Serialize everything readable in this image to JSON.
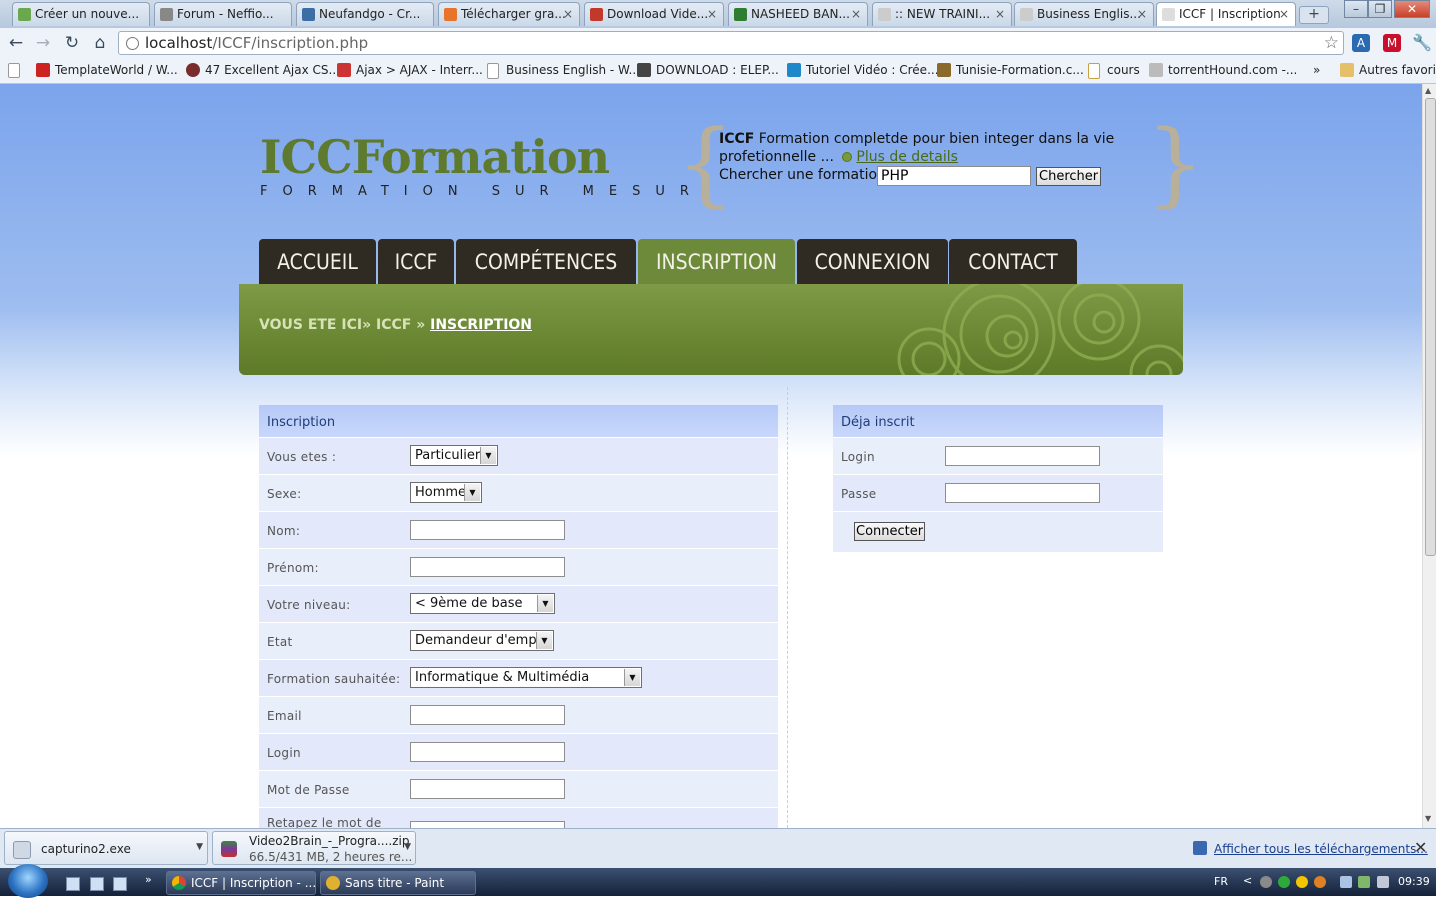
{
  "browser": {
    "tabs": [
      {
        "label": "Créer un nouve...",
        "color": "#6aa84f"
      },
      {
        "label": "Forum - Neffio...",
        "color": "#888888"
      },
      {
        "label": "Neufandgo - Cr...",
        "color": "#3b6ea5"
      },
      {
        "label": "Télécharger gra...",
        "color": "#e8732a"
      },
      {
        "label": "Download Vide...",
        "color": "#c0392b"
      },
      {
        "label": "NASHEED BAN...",
        "color": "#2e7d32"
      },
      {
        "label": ":: NEW TRAINI...",
        "color": "#bbbbbb"
      },
      {
        "label": "Business Englis...",
        "color": "#bbbbbb"
      },
      {
        "label": "ICCF | Inscription",
        "color": "#bbbbbb"
      }
    ],
    "url_host": "localhost",
    "url_path": "/ICCF/inscription.php",
    "bookmarks": [
      {
        "label": "TemplateWorld / W...",
        "color": "#cc2222"
      },
      {
        "label": "47 Excellent Ajax CS...",
        "color": "#7a2b2b"
      },
      {
        "label": "Ajax > AJAX - Interr...",
        "color": "#cc3333"
      },
      {
        "label": "Business English - W...",
        "color": "#dddddd"
      },
      {
        "label": "DOWNLOAD : ELEP...",
        "color": "#444444"
      },
      {
        "label": "Tutoriel Vidéo : Crée...",
        "color": "#1e88c8"
      },
      {
        "label": "Tunisie-Formation.c...",
        "color": "#8a6a2a"
      },
      {
        "label": "cours",
        "color": "#e0c070"
      },
      {
        "label": "torrentHound.com -...",
        "color": "#bbbbbb"
      }
    ],
    "bookmarks_more": "»",
    "other_bookmarks": "Autres favoris"
  },
  "site": {
    "logo": "ICCFormation",
    "tagline": "FORMATION SUR MESUR",
    "promo_brand": "ICCF",
    "promo_text": "Formation completde pour bien integer dans la vie profetionnelle ...",
    "promo_more": "Plus de details",
    "search_label": "Chercher une formation:",
    "search_value": "PHP",
    "search_button": "Chercher",
    "nav": [
      "ACCUEIL",
      "ICCF",
      "COMPÉTENCES",
      "INSCRIPTION",
      "CONNEXION",
      "CONTACT"
    ],
    "nav_active": "INSCRIPTION",
    "breadcrumb_prefix": "VOUS ETE ICI",
    "breadcrumb_sep": "»",
    "breadcrumb_mid": "ICCF",
    "breadcrumb_current": "INSCRIPTION"
  },
  "inscription": {
    "title": "Inscription",
    "rows": [
      {
        "label": "Vous etes :",
        "type": "select",
        "value": "Particulier"
      },
      {
        "label": "Sexe:",
        "type": "select",
        "value": "Homme"
      },
      {
        "label": "Nom:",
        "type": "text",
        "value": ""
      },
      {
        "label": "Prénom:",
        "type": "text",
        "value": ""
      },
      {
        "label": "Votre niveau:",
        "type": "select",
        "value": "< 9ème de base"
      },
      {
        "label": "Etat",
        "type": "select",
        "value": "Demandeur d'emploi"
      },
      {
        "label": "Formation sauhaitée:",
        "type": "select",
        "value": "Informatique & Multimédia"
      },
      {
        "label": "Email",
        "type": "text",
        "value": ""
      },
      {
        "label": "Login",
        "type": "text",
        "value": ""
      },
      {
        "label": "Mot de Passe",
        "type": "text",
        "value": ""
      },
      {
        "label": "Retapez le mot de",
        "type": "text",
        "value": ""
      }
    ]
  },
  "deja_inscrit": {
    "title": "Déja inscrit",
    "login_label": "Login",
    "passe_label": "Passe",
    "button": "Connecter"
  },
  "downloads": [
    {
      "name": "capturino2.exe",
      "status": ""
    },
    {
      "name": "Video2Brain_-_Progra....zip",
      "status": "66.5/431 MB, 2 heures re..."
    }
  ],
  "downloads_show_all": "Afficher tous les téléchargements...",
  "taskbar": {
    "items": [
      "ICCF | Inscription - ...",
      "Sans titre - Paint"
    ],
    "lang": "FR",
    "clock": "09:39"
  }
}
